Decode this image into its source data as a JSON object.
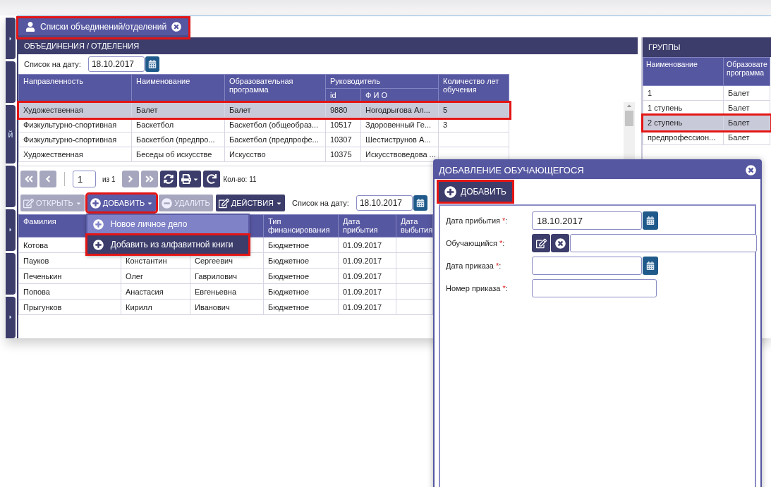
{
  "sidebar": [
    {
      "arrow": true
    },
    {
      "arrow": false
    },
    {
      "arrow": false,
      "label": "й"
    },
    {
      "arrow": false
    },
    {
      "arrow": true
    },
    {
      "arrow": false
    },
    {
      "arrow": true
    }
  ],
  "tab": {
    "label": "Списки объединений/отделений",
    "selected": true,
    "highlighted": true
  },
  "units_panel": {
    "title": "ОБЪЕДИНЕНИЯ / ОТДЕЛЕНИЯ",
    "date_filter": {
      "label": "Список на дату:",
      "value": "18.10.2017"
    },
    "table": {
      "columns": [
        {
          "label": "Направленность"
        },
        {
          "label": "Наименование"
        },
        {
          "label": "Образовательная программа"
        },
        {
          "label": "Руководитель",
          "colspan": 2,
          "children": [
            {
              "label": "id"
            },
            {
              "label": "Ф И О"
            }
          ]
        },
        {
          "label": "Количество лет обучения"
        }
      ],
      "rows": [
        {
          "cells": [
            "Художественная",
            "Балет",
            "Балет",
            "9880",
            "Ногодрыгова Ал...",
            "5"
          ],
          "selected": true,
          "highlighted": true
        },
        {
          "cells": [
            "Физкультурно-спортивная",
            "Баскетбол",
            "Баскетбол (общеобраз...",
            "10517",
            "Здоровенный Ге...",
            "3"
          ],
          "selected": false,
          "highlighted": false
        },
        {
          "cells": [
            "Физкультурно-спортивная",
            "Баскетбол (предпро...",
            "Баскетбол (предпрофе...",
            "10307",
            "Шестиструнов А...",
            null
          ],
          "selected": false,
          "highlighted": false
        },
        {
          "cells": [
            "Художественная",
            "Беседы об искусстве",
            "Искусство",
            "10375",
            "Искусствоведова ...",
            null
          ],
          "selected": false,
          "highlighted": false
        }
      ]
    },
    "pager": {
      "buttons": [
        {
          "kind": "first",
          "disabled": true
        },
        {
          "kind": "prev",
          "disabled": true
        }
      ],
      "page": "1",
      "of": "из 1",
      "after": [
        {
          "kind": "next",
          "disabled": true
        },
        {
          "kind": "last",
          "disabled": true
        },
        {
          "kind": "refresh",
          "disabled": false
        },
        {
          "kind": "print",
          "disabled": false
        },
        {
          "kind": "reload",
          "disabled": false
        }
      ],
      "count": "Кол-во: 11"
    },
    "toolbar": {
      "buttons": [
        {
          "kind": "open",
          "label": "ОТКРЫТЬ",
          "disabled": true,
          "dropdown": true,
          "expanded": false,
          "highlighted": false
        },
        {
          "kind": "add",
          "label": "ДОБАВИТЬ",
          "disabled": false,
          "dropdown": true,
          "expanded": true,
          "highlighted": true
        },
        {
          "kind": "delete",
          "label": "УДАЛИТЬ",
          "disabled": true,
          "dropdown": false,
          "expanded": false,
          "highlighted": false
        },
        {
          "kind": "actions",
          "label": "ДЕЙСТВИЯ",
          "disabled": false,
          "dropdown": true,
          "expanded": false,
          "highlighted": false
        }
      ],
      "date_filter": {
        "label": "Список на дату:",
        "value": "18.10.2017"
      }
    },
    "add_menu": {
      "items": [
        {
          "label": "Новое личное дело",
          "selected": false,
          "highlighted": false
        },
        {
          "label": "Добавить из алфавитной книги",
          "selected": true,
          "highlighted": true
        }
      ]
    },
    "students_table": {
      "columns": [
        "Фамилия",
        null,
        null,
        "Тип финансирования",
        "Дата прибытия",
        "Дата выбытия"
      ],
      "rows": [
        [
          "Котова",
          null,
          null,
          "Бюджетное",
          "01.09.2017",
          null
        ],
        [
          "Пауков",
          "Константин",
          "Сергеевич",
          "Бюджетное",
          "01.09.2017",
          null
        ],
        [
          "Печенькин",
          "Олег",
          "Гаврилович",
          "Бюджетное",
          "01.09.2017",
          null
        ],
        [
          "Попова",
          "Анастасия",
          "Евгеньевна",
          "Бюджетное",
          "01.09.2017",
          null
        ],
        [
          "Прыгунков",
          "Кирилл",
          "Иванович",
          "Бюджетное",
          "01.09.2017",
          null
        ]
      ]
    }
  },
  "groups_panel": {
    "title": "ГРУППЫ",
    "columns": [
      "Наименование",
      "Образовате программа"
    ],
    "rows": [
      {
        "cells": [
          "1",
          "Балет"
        ],
        "selected": false,
        "highlighted": false
      },
      {
        "cells": [
          "1 ступень",
          "Балет"
        ],
        "selected": false,
        "highlighted": false
      },
      {
        "cells": [
          "2 ступень",
          "Балет"
        ],
        "selected": true,
        "highlighted": true
      },
      {
        "cells": [
          "предпрофессион...",
          "Балет"
        ],
        "selected": false,
        "highlighted": false
      }
    ]
  },
  "dialog": {
    "title": "ДОБАВЛЕНИЕ ОБУЧАЮЩЕГОСЯ",
    "add_button": {
      "label": "ДОБАВИТЬ",
      "highlighted": true
    },
    "fields": [
      {
        "kind": "date",
        "label": "Дата прибытия",
        "required_mark": "*",
        "tail": ":",
        "value": "18.10.2017"
      },
      {
        "kind": "picker",
        "label": "Обучающийся",
        "required_mark": "*",
        "tail": ":"
      },
      {
        "kind": "date",
        "label": "Дата приказа",
        "required_mark": "*",
        "tail": ":"
      },
      {
        "kind": "text",
        "label": "Номер приказа",
        "required_mark": "*",
        "tail": ":"
      }
    ]
  }
}
